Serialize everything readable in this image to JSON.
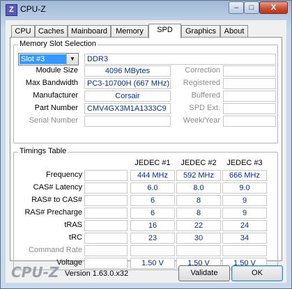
{
  "window": {
    "title": "CPU-Z",
    "app_icon_letter": "Z"
  },
  "tabs": [
    "CPU",
    "Caches",
    "Mainboard",
    "Memory",
    "SPD",
    "Graphics",
    "About"
  ],
  "active_tab": "SPD",
  "memory_slot": {
    "group_title": "Memory Slot Selection",
    "slot_selected": "Slot #3",
    "type": "DDR3",
    "labels": {
      "module_size": "Module Size",
      "max_bandwidth": "Max Bandwidth",
      "manufacturer": "Manufacturer",
      "part_number": "Part Number",
      "serial_number": "Serial Number",
      "correction": "Correction",
      "registered": "Registered",
      "buffered": "Buffered",
      "spd_ext": "SPD Ext.",
      "week_year": "Week/Year"
    },
    "values": {
      "module_size": "4096 MBytes",
      "max_bandwidth": "PC3-10700H (667 MHz)",
      "manufacturer": "Corsair",
      "part_number": "CMV4GX3M1A1333C9",
      "serial_number": "",
      "correction": "",
      "registered": "",
      "buffered": "",
      "spd_ext": "",
      "week_year": ""
    }
  },
  "timings": {
    "group_title": "Timings Table",
    "columns": [
      "JEDEC #1",
      "JEDEC #2",
      "JEDEC #3"
    ],
    "rows": [
      {
        "label": "Frequency",
        "first": "",
        "values": [
          "444 MHz",
          "592 MHz",
          "666 MHz"
        ]
      },
      {
        "label": "CAS# Latency",
        "first": "",
        "values": [
          "6.0",
          "8.0",
          "9.0"
        ]
      },
      {
        "label": "RAS# to CAS#",
        "first": "",
        "values": [
          "6",
          "8",
          "9"
        ]
      },
      {
        "label": "RAS# Precharge",
        "first": "",
        "values": [
          "6",
          "8",
          "9"
        ]
      },
      {
        "label": "tRAS",
        "first": "",
        "values": [
          "16",
          "22",
          "24"
        ]
      },
      {
        "label": "tRC",
        "first": "",
        "values": [
          "23",
          "30",
          "34"
        ]
      },
      {
        "label": "Command Rate",
        "first": "",
        "values": [
          "",
          "",
          ""
        ]
      },
      {
        "label": "Voltage",
        "first": "",
        "values": [
          "1.50 V",
          "1.50 V",
          "1.50 V"
        ]
      }
    ]
  },
  "footer": {
    "logo": "CPU-Z",
    "version": "Version 1.63.0.x32",
    "validate_label": "Validate",
    "ok_label": "OK"
  },
  "window_controls": {
    "minimize": "–",
    "maximize": "□",
    "close": "X"
  }
}
